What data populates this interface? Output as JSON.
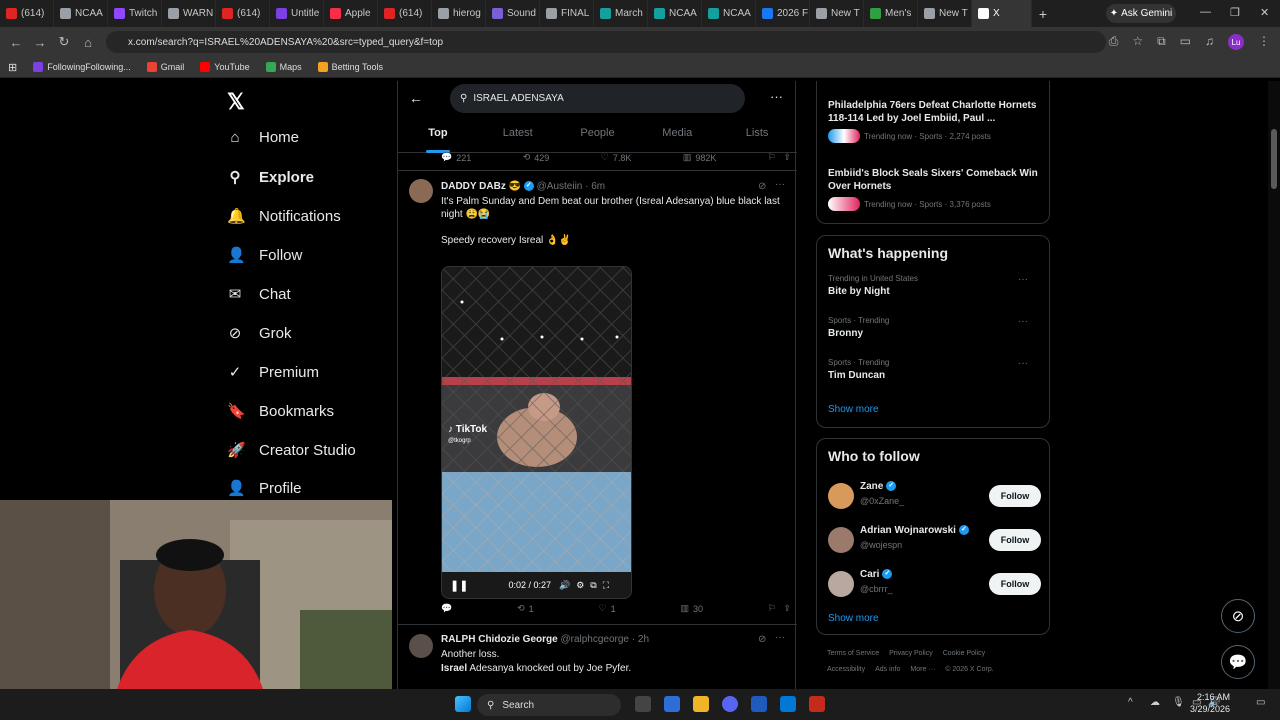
{
  "browser": {
    "tabs": [
      {
        "label": "(614)",
        "color": "#e02424"
      },
      {
        "label": "NCAA",
        "color": "#9aa0a6"
      },
      {
        "label": "Twitch",
        "color": "#9146ff"
      },
      {
        "label": "WARN",
        "color": "#9aa0a6"
      },
      {
        "label": "(614)",
        "color": "#e02424"
      },
      {
        "label": "Untitle",
        "color": "#7b3fe4"
      },
      {
        "label": "Apple",
        "color": "#fa2d48"
      },
      {
        "label": "(614)",
        "color": "#e02424"
      },
      {
        "label": "hierog",
        "color": "#9aa0a6"
      },
      {
        "label": "Sound",
        "color": "#7b5fd6"
      },
      {
        "label": "FINAL",
        "color": "#9aa0a6"
      },
      {
        "label": "March",
        "color": "#15a0a0"
      },
      {
        "label": "NCAA",
        "color": "#15a0a0"
      },
      {
        "label": "NCAA",
        "color": "#15a0a0"
      },
      {
        "label": "2026 F",
        "color": "#1877f2"
      },
      {
        "label": "New T",
        "color": "#9aa0a6"
      },
      {
        "label": "Men's",
        "color": "#2ea043"
      },
      {
        "label": "New T",
        "color": "#9aa0a6"
      },
      {
        "label": "X",
        "color": "#ffffff"
      }
    ],
    "ask_gemini": "Ask Gemini",
    "url": "x.com/search?q=ISRAEL%20ADENSAYA%20&src=typed_query&f=top",
    "bookmarks": [
      {
        "label": "FollowingFollowing...",
        "color": "#7b3fe4"
      },
      {
        "label": "Gmail",
        "color": "#ea4335"
      },
      {
        "label": "YouTube",
        "color": "#ff0000"
      },
      {
        "label": "Maps",
        "color": "#34a853"
      },
      {
        "label": "Betting Tools",
        "color": "#f4a020"
      }
    ],
    "profile_initials": "Lu"
  },
  "leftnav": {
    "items": [
      {
        "label": "Home",
        "icon": "⌂"
      },
      {
        "label": "Explore",
        "icon": "⚲"
      },
      {
        "label": "Notifications",
        "icon": "🔔"
      },
      {
        "label": "Follow",
        "icon": "👤"
      },
      {
        "label": "Chat",
        "icon": "✉"
      },
      {
        "label": "Grok",
        "icon": "⊘"
      },
      {
        "label": "Premium",
        "icon": "✓"
      },
      {
        "label": "Bookmarks",
        "icon": "🔖"
      },
      {
        "label": "Creator Studio",
        "icon": "🚀"
      },
      {
        "label": "Profile",
        "icon": "👤"
      }
    ]
  },
  "search": {
    "query": "ISRAEL ADENSAYA",
    "tabs": [
      "Top",
      "Latest",
      "People",
      "Media",
      "Lists"
    ]
  },
  "prev_tweet_actions": {
    "replies": "221",
    "reposts": "429",
    "likes": "7.8K",
    "views": "982K"
  },
  "tweet1": {
    "name": "DADDY DABz",
    "handle": "@Austeiin",
    "time": "· 6m",
    "text1": "It's Palm Sunday and Dem beat our brother (Isreal Adesanya) blue black last night 😩😭",
    "text2": "Speedy recovery Isreal 👌✌",
    "video": {
      "watermark": "TikTok",
      "watermark_handle": "@tkogrp",
      "time": "0:02 / 0:27"
    },
    "actions": {
      "replies": "",
      "reposts": "1",
      "likes": "1",
      "views": "30"
    }
  },
  "tweet2": {
    "name": "RALPH Chidozie George",
    "handle": "@ralphcgeorge",
    "time": "· 2h",
    "line1": "Another loss.",
    "line2_bold": "Israel",
    "line2_rest": " Adesanya knocked out by Joe Pyfer."
  },
  "right": {
    "trends_top": [
      {
        "title": "Philadelphia 76ers Defeat Charlotte Hornets 118-114 Led by Joel Embiid, Paul ...",
        "meta": "Trending now · Sports · 2,274 posts"
      },
      {
        "title": "Embiid's Block Seals Sixers' Comeback Win Over Hornets",
        "meta": "Trending now · Sports · 3,376 posts"
      }
    ],
    "happening_title": "What's happening",
    "happening": [
      {
        "context": "Trending in United States",
        "topic": "Bite by Night"
      },
      {
        "context": "Sports · Trending",
        "topic": "Bronny"
      },
      {
        "context": "Sports · Trending",
        "topic": "Tim Duncan"
      }
    ],
    "show_more": "Show more",
    "wtf_title": "Who to follow",
    "follow": [
      {
        "name": "Zane",
        "handle": "@0xZane_",
        "button": "Follow",
        "color": "#d89a5a"
      },
      {
        "name": "Adrian Wojnarowski",
        "handle": "@wojespn",
        "button": "Follow",
        "color": "#9a7a6a"
      },
      {
        "name": "Cari",
        "handle": "@cbrrr_",
        "button": "Follow",
        "color": "#b8a8a0"
      }
    ],
    "footer1": [
      "Terms of Service",
      "Privacy Policy",
      "Cookie Policy"
    ],
    "footer2": [
      "Accessibility",
      "Ads info",
      "More ···",
      "© 2026 X Corp."
    ]
  },
  "taskbar": {
    "search": "Search",
    "time": "2:16 AM",
    "date": "3/29/2026"
  }
}
